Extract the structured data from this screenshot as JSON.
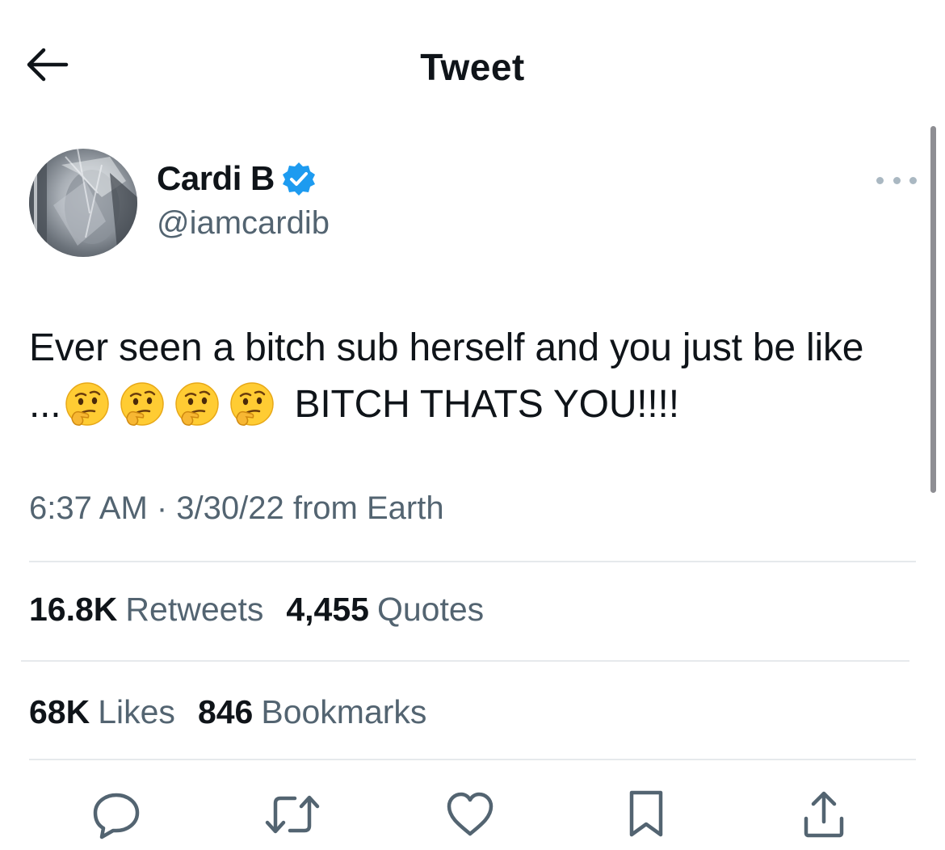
{
  "header": {
    "title": "Tweet",
    "back_icon": "arrow-left-icon"
  },
  "tweet": {
    "author": {
      "name": "Cardi B",
      "handle": "@iamcardib",
      "verified": true,
      "verified_color": "#1d9bf0"
    },
    "text_line1": "Ever seen a bitch sub herself and you just be like",
    "text_line2_prefix": "...",
    "emoji_count": 4,
    "emoji_name": "thinking-face",
    "text_line2_suffix": " BITCH THATS YOU!!!!",
    "timestamp": "6:37 AM · 3/30/22 from Earth"
  },
  "stats": {
    "retweets": {
      "count": "16.8K",
      "label": "Retweets"
    },
    "quotes": {
      "count": "4,455",
      "label": "Quotes"
    },
    "likes": {
      "count": "68K",
      "label": "Likes"
    },
    "bookmarks": {
      "count": "846",
      "label": "Bookmarks"
    }
  },
  "actions": [
    "reply-icon",
    "retweet-icon",
    "like-icon",
    "bookmark-icon",
    "share-icon"
  ],
  "colors": {
    "text": "#0f1419",
    "secondary": "#536471",
    "divider": "#e6e9ec"
  }
}
